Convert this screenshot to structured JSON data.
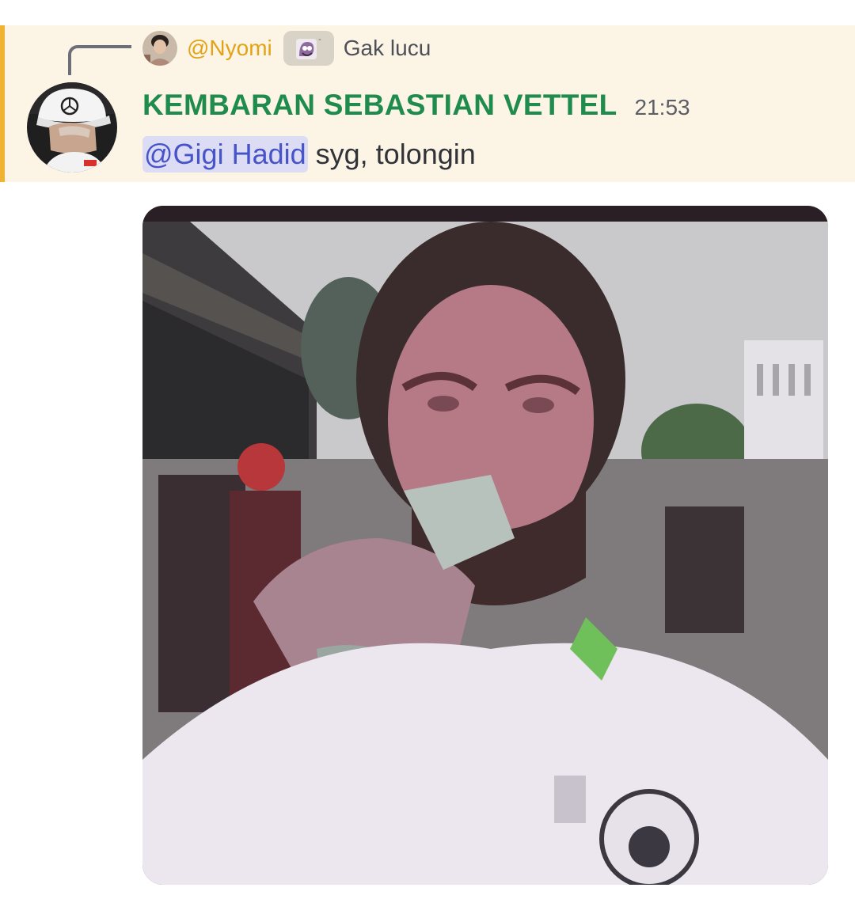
{
  "reply": {
    "author": "@Nyomi",
    "emoji_icon": "custom-emoji-icon",
    "text": "Gak lucu"
  },
  "message": {
    "author": "KEMBARAN SEBASTIAN VETTEL",
    "timestamp": "21:53",
    "mention": "@Gigi Hadid",
    "text": "syg, tolongin"
  },
  "attachment": {
    "type": "image",
    "icon": "video-attachment-image"
  },
  "colors": {
    "highlight_background": "#fcf5e6",
    "highlight_bar": "#f0b232",
    "reply_author": "#e3a316",
    "author_name": "#1f8b4c",
    "mention_text": "#4654c8",
    "mention_background": "#dcdcf4"
  }
}
